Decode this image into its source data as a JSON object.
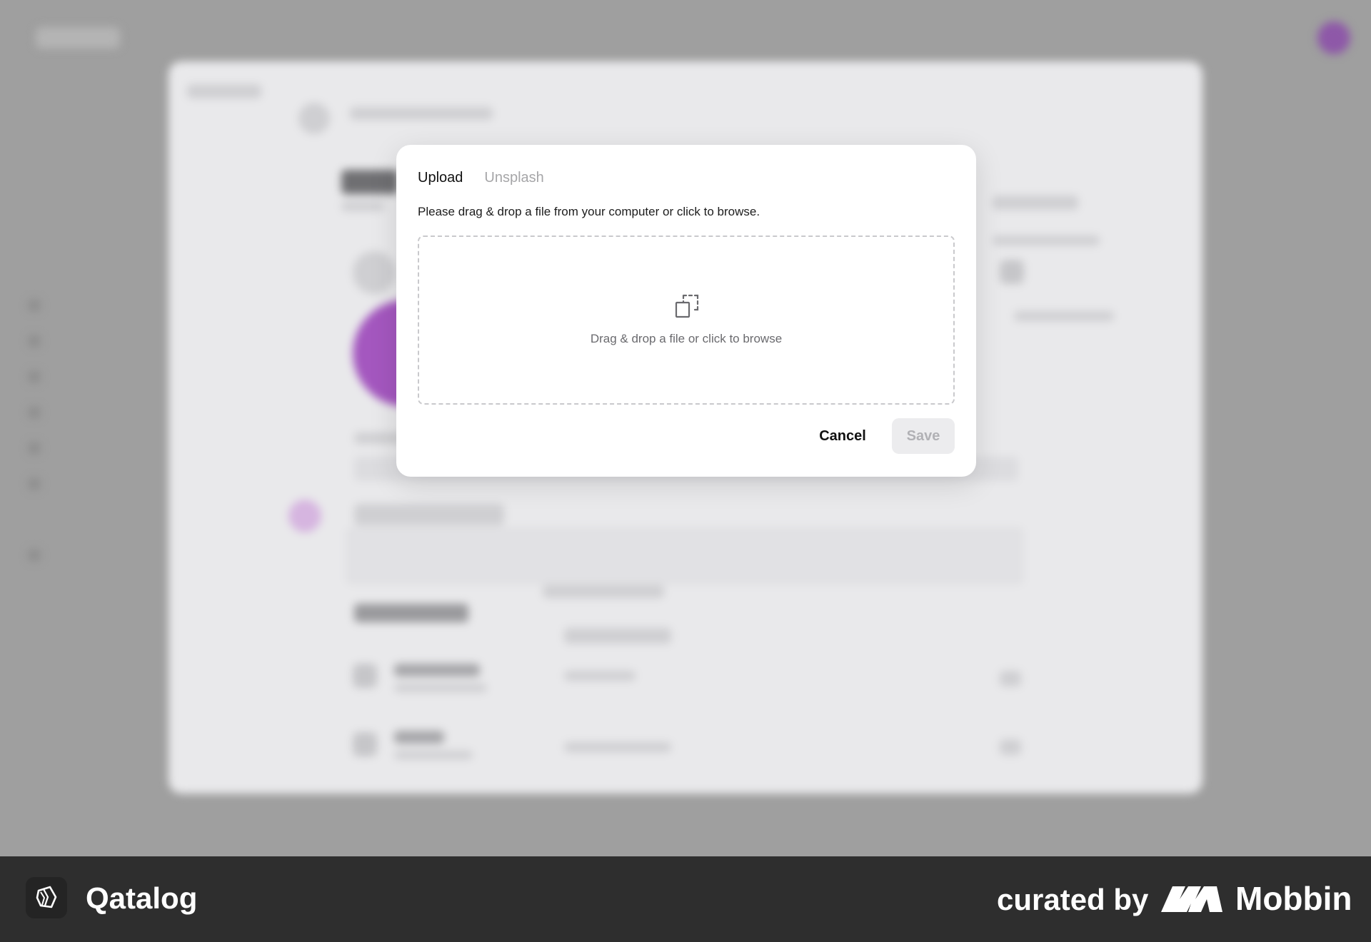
{
  "modal": {
    "tabs": [
      {
        "label": "Upload",
        "active": true
      },
      {
        "label": "Unsplash",
        "active": false
      }
    ],
    "instruction": "Please drag & drop a file from your computer or click to browse.",
    "dropzone": {
      "icon": "image-placeholder-icon",
      "text": "Drag & drop a file or click to browse"
    },
    "cancel_label": "Cancel",
    "save_label": "Save"
  },
  "footer": {
    "brand_name": "Qatalog",
    "brand_icon": "qatalog-logo-icon",
    "curated_by": "curated by",
    "curator_name": "Mobbin",
    "curator_icon": "mobbin-logo-icon"
  },
  "colors": {
    "overlay": "#9f9f9f",
    "modal_bg": "#ffffff",
    "footer_bg": "#2e2e2e",
    "accent_purple": "#a457bf",
    "save_disabled_bg": "#ececee"
  }
}
